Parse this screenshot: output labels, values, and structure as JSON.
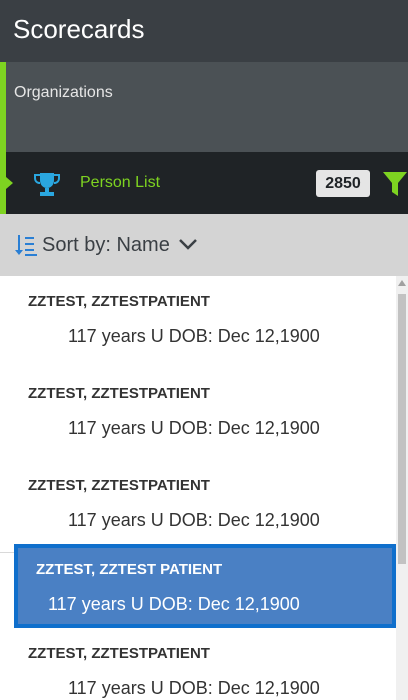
{
  "header": {
    "title": "Scorecards"
  },
  "sidebar": {
    "organizations_label": "Organizations"
  },
  "person_list": {
    "label": "Person List",
    "count": "2850",
    "accent_color": "#7ed321"
  },
  "sort": {
    "label": "Sort by: Name"
  },
  "patients": [
    {
      "name": "ZZTEST, ZZTESTPATIENT",
      "details": "117 years U DOB: Dec 12,1900"
    },
    {
      "name": "ZZTEST, ZZTESTPATIENT",
      "details": "117 years U DOB: Dec 12,1900"
    },
    {
      "name": "ZZTEST, ZZTESTPATIENT",
      "details": "117 years U DOB: Dec 12,1900"
    },
    {
      "name": "ZZTEST, ZZTEST PATIENT",
      "details": "117 years U DOB: Dec 12,1900"
    },
    {
      "name": "ZZTEST, ZZTESTPATIENT",
      "details": "117 years U DOB: Dec 12,1900"
    }
  ],
  "selected_index": 3,
  "colors": {
    "selected_bg": "#4a80c4",
    "selected_border": "#0f6fcc"
  }
}
